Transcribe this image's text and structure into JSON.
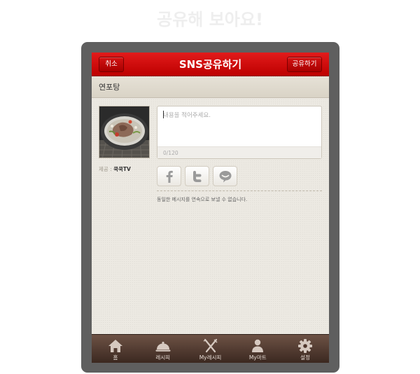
{
  "page": {
    "heading": "공유해 보아요!"
  },
  "header": {
    "cancel_label": "취소",
    "title": "SNS공유하기",
    "share_label": "공유하기"
  },
  "recipe": {
    "name": "연포탕"
  },
  "credit": {
    "label": "제공 : ",
    "source": "쿡쿡TV"
  },
  "compose": {
    "placeholder": "내용을 적어주세요.",
    "value": "",
    "count": "0/120"
  },
  "sns": [
    {
      "name": "facebook",
      "icon": "facebook-icon"
    },
    {
      "name": "twitter",
      "icon": "twitter-icon"
    },
    {
      "name": "kakaotalk",
      "icon": "speech-bubble-icon"
    }
  ],
  "notice": "동일한 메시지를 연속으로 보낼 수 없습니다.",
  "tabs": [
    {
      "label": "홈",
      "icon": "home-icon"
    },
    {
      "label": "레시피",
      "icon": "cloche-icon"
    },
    {
      "label": "My레시피",
      "icon": "fork-knife-icon"
    },
    {
      "label": "My마트",
      "icon": "person-icon"
    },
    {
      "label": "설정",
      "icon": "gear-icon"
    }
  ],
  "colors": {
    "header_red": "#d10a0a",
    "tabbar_brown": "#4e362c",
    "background_beige": "#ece9e2",
    "device_frame": "#5f5f5f"
  }
}
